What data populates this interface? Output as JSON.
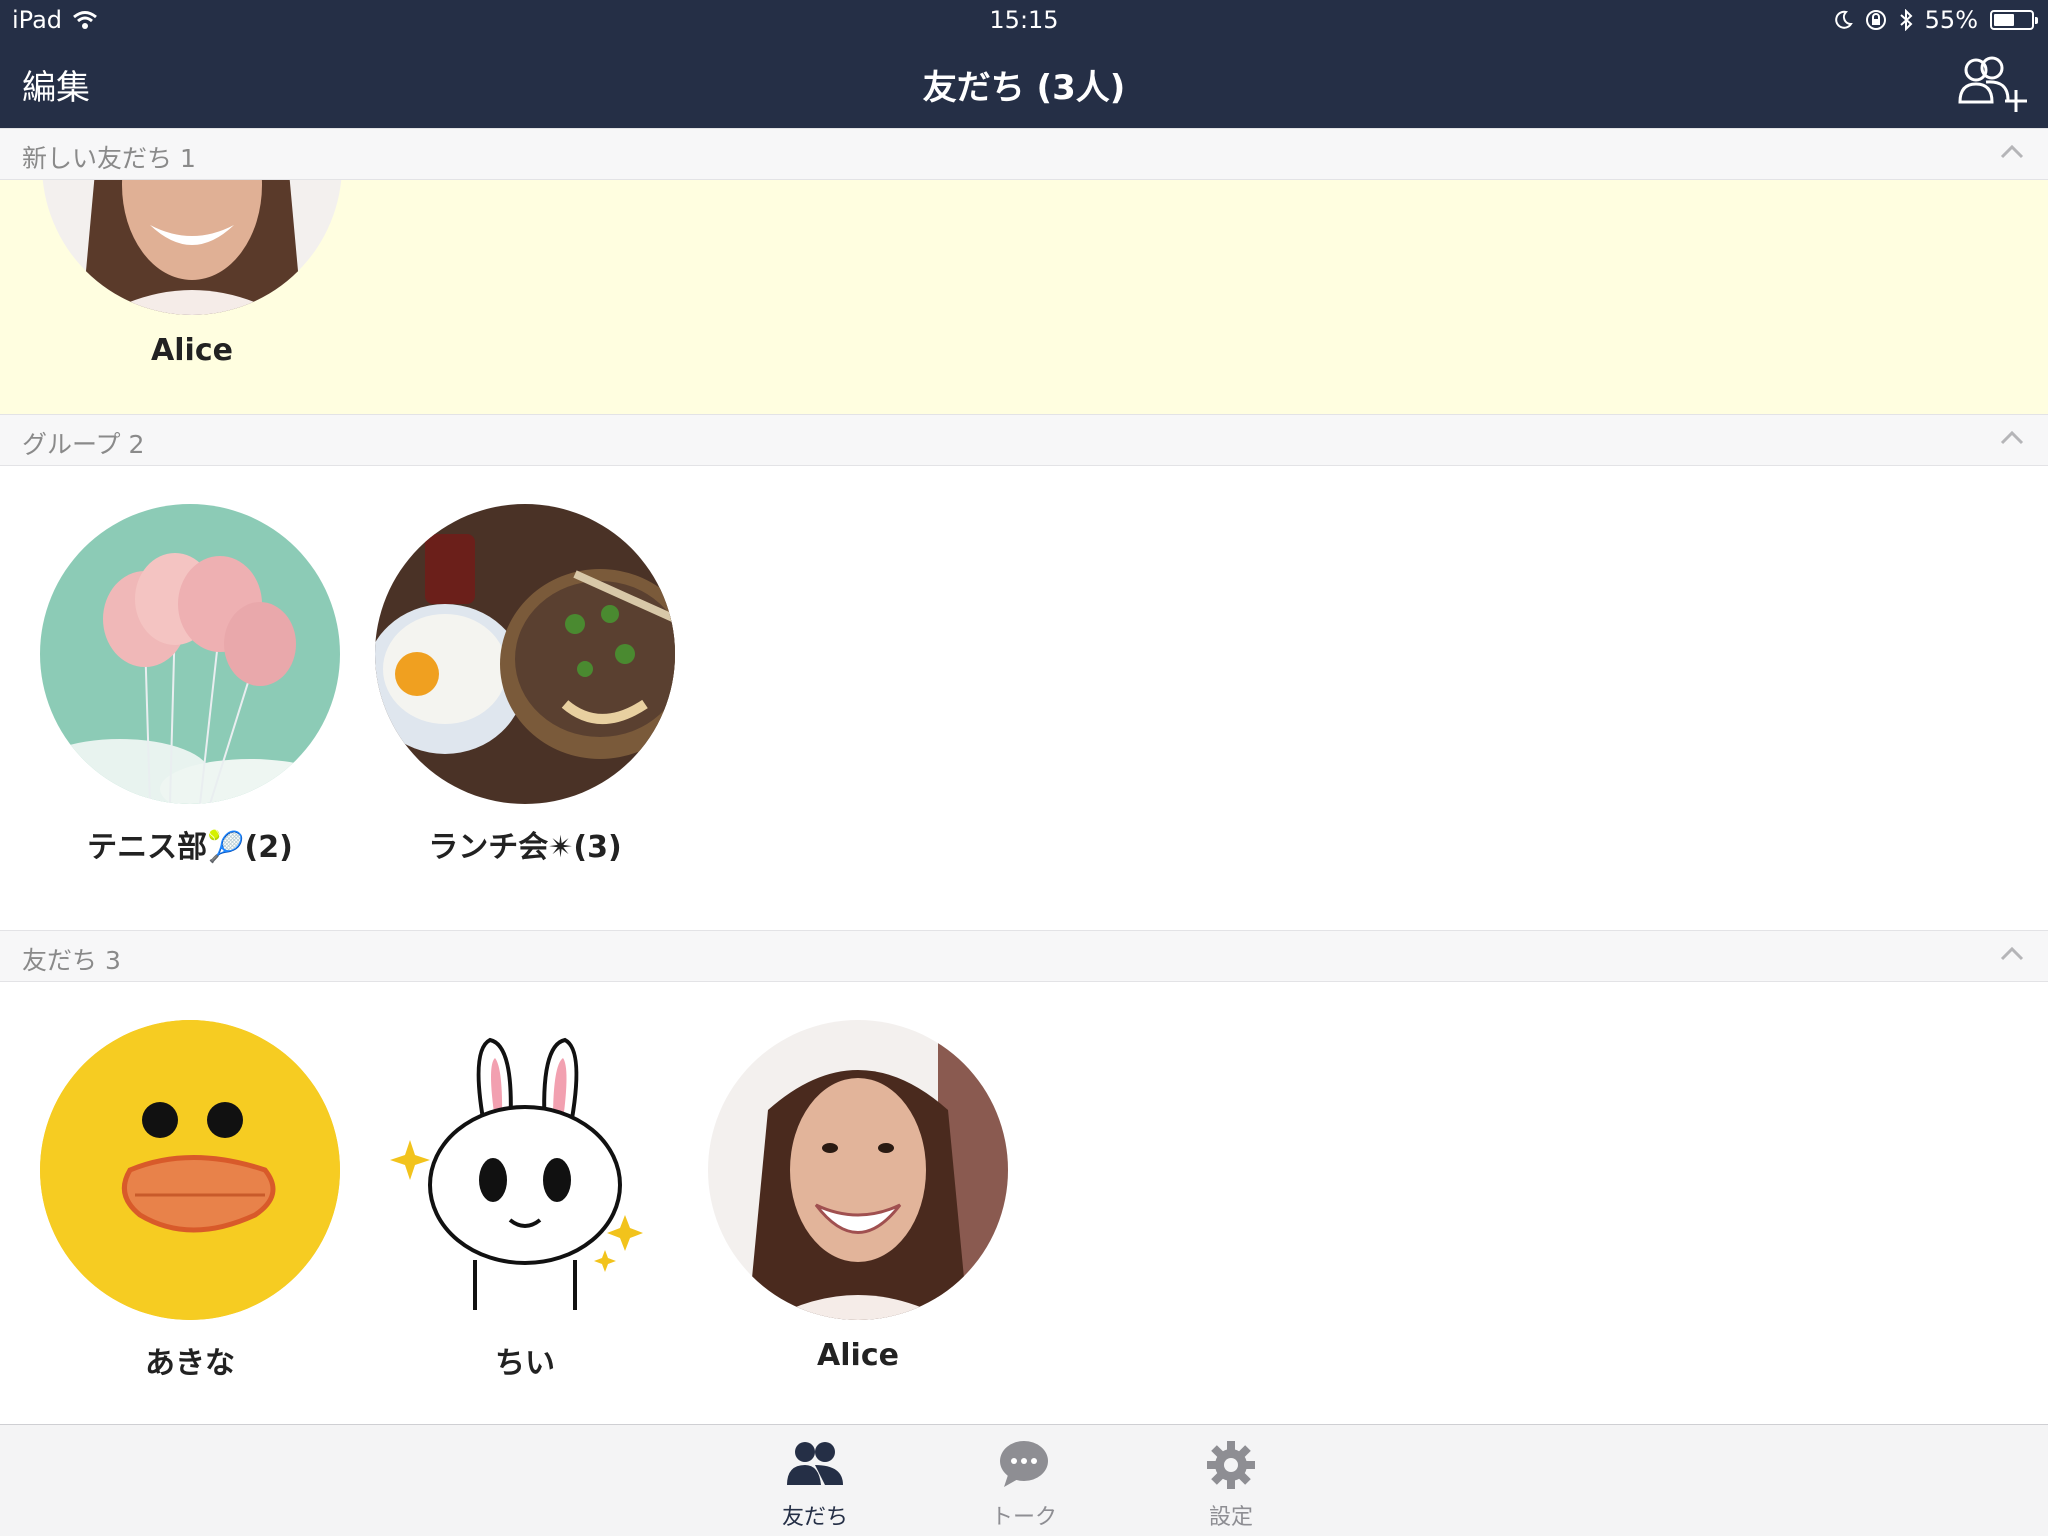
{
  "status_bar": {
    "device": "iPad",
    "time": "15:15",
    "battery": "55%",
    "battery_level": 0.55
  },
  "nav": {
    "edit_label": "編集",
    "title": "友だち (3人)"
  },
  "sections": {
    "new_friends": {
      "label": "新しい友だち 1",
      "items": [
        {
          "name": "Alice"
        }
      ]
    },
    "groups": {
      "label": "グループ 2",
      "items": [
        {
          "name": "テニス部🎾(2)"
        },
        {
          "name": "ランチ会✴(3)"
        }
      ]
    },
    "friends": {
      "label": "友だち 3",
      "items": [
        {
          "name": "あきな"
        },
        {
          "name": "ちい"
        },
        {
          "name": "Alice"
        }
      ]
    }
  },
  "tabbar": {
    "tabs": [
      {
        "label": "友だち"
      },
      {
        "label": "トーク"
      },
      {
        "label": "設定"
      }
    ]
  },
  "colors": {
    "header": "#252f46",
    "new_bg": "#fffee0",
    "active_tab": "#252f46",
    "inactive_tab": "#8e8e93"
  }
}
